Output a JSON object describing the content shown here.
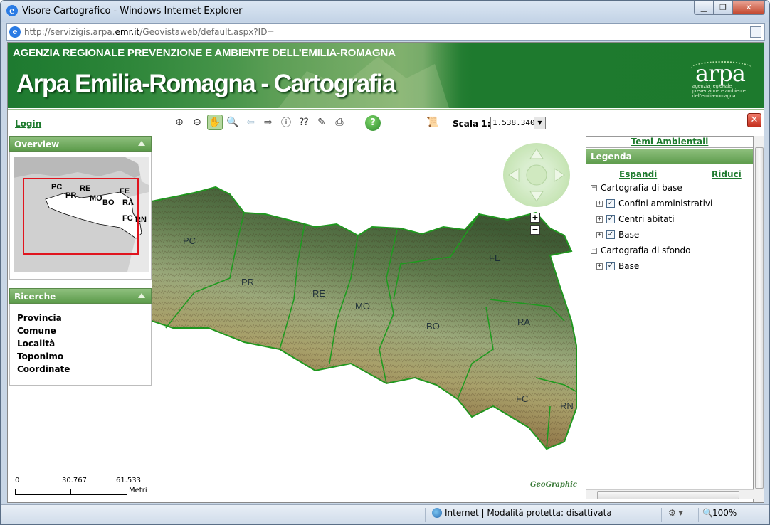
{
  "window": {
    "title": "Visore Cartografico - Windows Internet Explorer",
    "min_label": "▁",
    "max_label": "❐",
    "close_label": "✕"
  },
  "address": {
    "prefix": "http://servizigis.arpa.",
    "domain": "emr.it",
    "suffix": "/Geovistaweb/default.aspx?ID="
  },
  "banner": {
    "org": "AGENZIA REGIONALE PREVENZIONE E AMBIENTE DELL’EMILIA-ROMAGNA",
    "title": "Arpa Emilia-Romagna - Cartografia",
    "logo_text": "arpa",
    "logo_sub": "agenzia regionale prevenzione e ambiente dell'emilia-romagna"
  },
  "toolbar": {
    "login": "Login",
    "scala_label": "Scala 1:",
    "scala_value": "1.538.340",
    "tools": [
      {
        "name": "zoom-in-icon",
        "glyph": "⊕",
        "active": false,
        "disabled": false
      },
      {
        "name": "zoom-out-icon",
        "glyph": "⊖",
        "active": false,
        "disabled": false
      },
      {
        "name": "pan-hand-icon",
        "glyph": "✋",
        "active": true,
        "disabled": false
      },
      {
        "name": "zoom-extent-icon",
        "glyph": "🔍",
        "active": false,
        "disabled": false
      },
      {
        "name": "back-arrow-icon",
        "glyph": "⇦",
        "active": false,
        "disabled": true
      },
      {
        "name": "forward-arrow-icon",
        "glyph": "⇨",
        "active": false,
        "disabled": false
      },
      {
        "name": "info-icon",
        "glyph": "ⓘ",
        "active": false,
        "disabled": false
      },
      {
        "name": "measure-icon",
        "glyph": "⁇",
        "active": false,
        "disabled": false
      },
      {
        "name": "select-icon",
        "glyph": "✎",
        "active": false,
        "disabled": false
      },
      {
        "name": "print-icon",
        "glyph": "⎙",
        "active": false,
        "disabled": false
      }
    ],
    "help_glyph": "?",
    "close_glyph": "✕"
  },
  "overview": {
    "title": "Overview",
    "labels": [
      "PC",
      "PR",
      "RE",
      "MO",
      "BO",
      "FE",
      "RA",
      "FC",
      "RN"
    ]
  },
  "ricerche": {
    "title": "Ricerche",
    "items": [
      "Provincia",
      "Comune",
      "Località",
      "Toponimo",
      "Coordinate"
    ]
  },
  "scalebar": {
    "ticks": [
      "0",
      "30.767",
      "61.533"
    ],
    "unit": "Metri"
  },
  "map": {
    "provinces": [
      "PC",
      "PR",
      "RE",
      "MO",
      "BO",
      "FE",
      "RA",
      "FC",
      "RN"
    ],
    "credit": "GeoGraphics",
    "zoom_plus": "+",
    "zoom_minus": "−"
  },
  "legend": {
    "temi_link": "Temi Ambientali",
    "title": "Legenda",
    "espandi": "Espandi",
    "riduci": "Riduci",
    "groups": [
      {
        "label": "Cartografia di base",
        "children": [
          "Confini amministrativi",
          "Centri abitati",
          "Base"
        ]
      },
      {
        "label": "Cartografia di sfondo",
        "children": [
          "Base"
        ]
      }
    ]
  },
  "status": {
    "text": "Internet | Modalità protetta: disattivata",
    "zoom": "100%"
  }
}
